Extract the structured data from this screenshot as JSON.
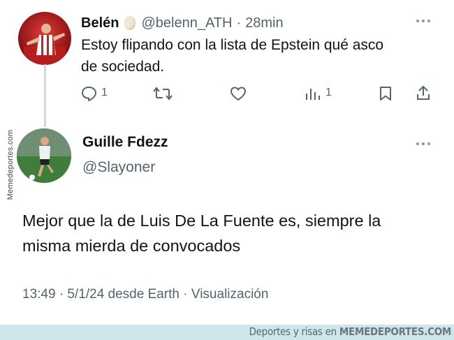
{
  "tweet1": {
    "display_name": "Belén",
    "emoji": "🥚",
    "handle": "@belenn_ATH",
    "time_sep": "·",
    "time": "28min",
    "text_line1": "Estoy flipando con la lista de Epstein qué asco",
    "text_line2": "de sociedad.",
    "actions": {
      "reply_count": "1",
      "retweet_count": "",
      "like_count": "",
      "views_count": "1"
    }
  },
  "tweet2": {
    "display_name": "Guille Fdezz",
    "handle": "@Slayoner",
    "text_line1": "Mejor que la de Luis De La Fuente es, siempre la",
    "text_line2": "misma mierda de convocados",
    "meta": "13:49 · 5/1/24 desde Earth · Visualización"
  },
  "watermark": {
    "side": "Memedeportes.com",
    "footer_prefix": "Deportes y risas en",
    "footer_site": "MEMEDEPORTES.COM"
  },
  "colors": {
    "text": "#0f1419",
    "muted": "#536471",
    "thread_line": "#cfd9de",
    "footer_bar": "#cfe5ec"
  }
}
